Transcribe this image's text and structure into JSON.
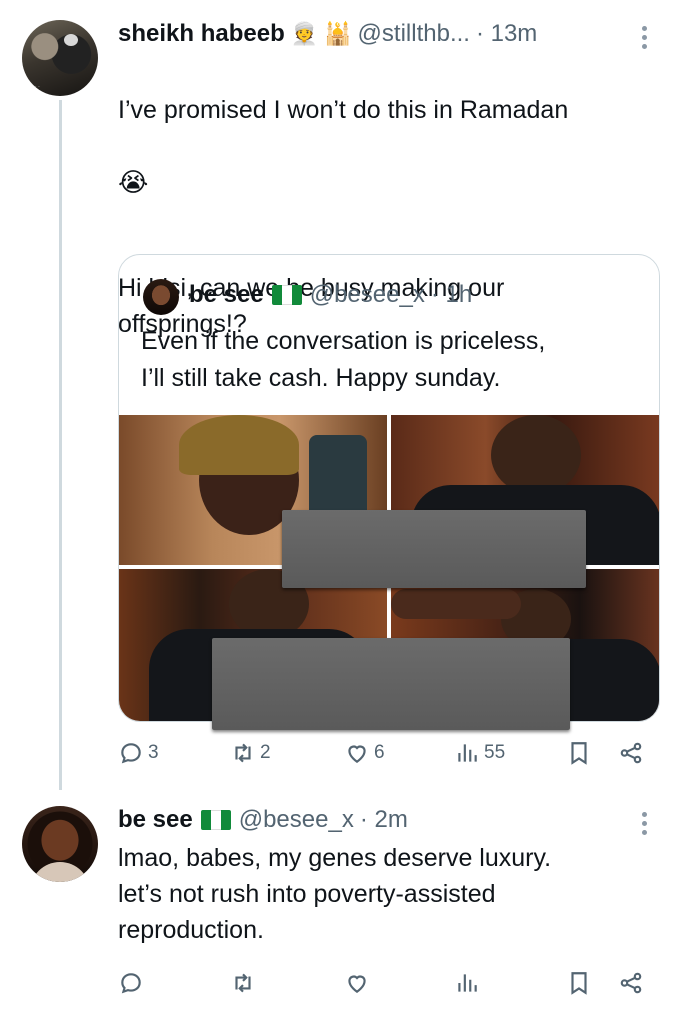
{
  "tweet1": {
    "display_name": "sheikh habeeb",
    "emojis": [
      "👳",
      "🕌"
    ],
    "handle": "@stillthb...",
    "time": "· 13m",
    "body_line1": "I’ve promised I won’t do this in Ramadan",
    "body_emoji": "😭",
    "body_line2": "Hi bisi, can we be busy making our\noffsprings!?",
    "actions": {
      "replies": "3",
      "reposts": "2",
      "likes": "6",
      "views": "55"
    }
  },
  "quote": {
    "display_name": "be see",
    "handle": "@besee_x",
    "time": "· 1h",
    "text": "Even if the conversation is priceless,\nI’ll still take cash. Happy sunday."
  },
  "tweet2": {
    "display_name": "be see",
    "handle": "@besee_x",
    "time": "· 2m",
    "body": "lmao, babes, my genes deserve luxury.\nlet’s not rush into poverty-assisted\nreproduction."
  },
  "colors": {
    "muted": "#536471",
    "border": "#cfd9de",
    "text": "#0f1419"
  },
  "icons": [
    "more-icon",
    "reply-icon",
    "repost-icon",
    "like-icon",
    "views-icon",
    "bookmark-icon",
    "share-icon",
    "nigeria-flag-icon"
  ]
}
